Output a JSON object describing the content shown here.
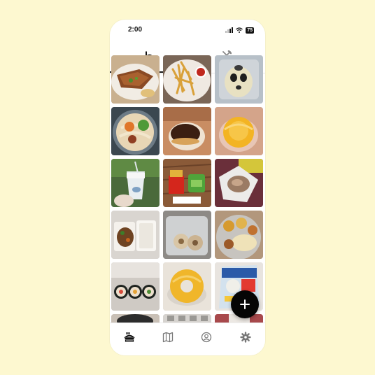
{
  "status": {
    "time": "2:00",
    "battery": "75"
  },
  "tabs": [
    {
      "id": "photos",
      "icon": "food-tray-icon",
      "selected": true
    },
    {
      "id": "restaurants",
      "icon": "fork-knife-icon",
      "selected": false
    }
  ],
  "photos": [
    "fried-cutlet-rice-plate",
    "french-fries-ketchup",
    "ghost-face-pastry",
    "udon-noodle-bowl",
    "chocolate-donut",
    "yellow-glazed-donut",
    "iced-drink-cup",
    "fast-food-fries-and-burger",
    "grilled-meat-wrap",
    "curry-with-rice-box",
    "dumplings-in-container",
    "indian-thali-naan",
    "sushi-rolls",
    "yellow-ring-donut",
    "snack-bag"
  ],
  "fab": {
    "icon": "plus-icon"
  },
  "bottom_nav": [
    {
      "id": "food",
      "icon": "food-tray-icon",
      "selected": true
    },
    {
      "id": "map",
      "icon": "map-icon",
      "selected": false
    },
    {
      "id": "profile",
      "icon": "user-circle-icon",
      "selected": false
    },
    {
      "id": "settings",
      "icon": "gear-icon",
      "selected": false
    }
  ]
}
